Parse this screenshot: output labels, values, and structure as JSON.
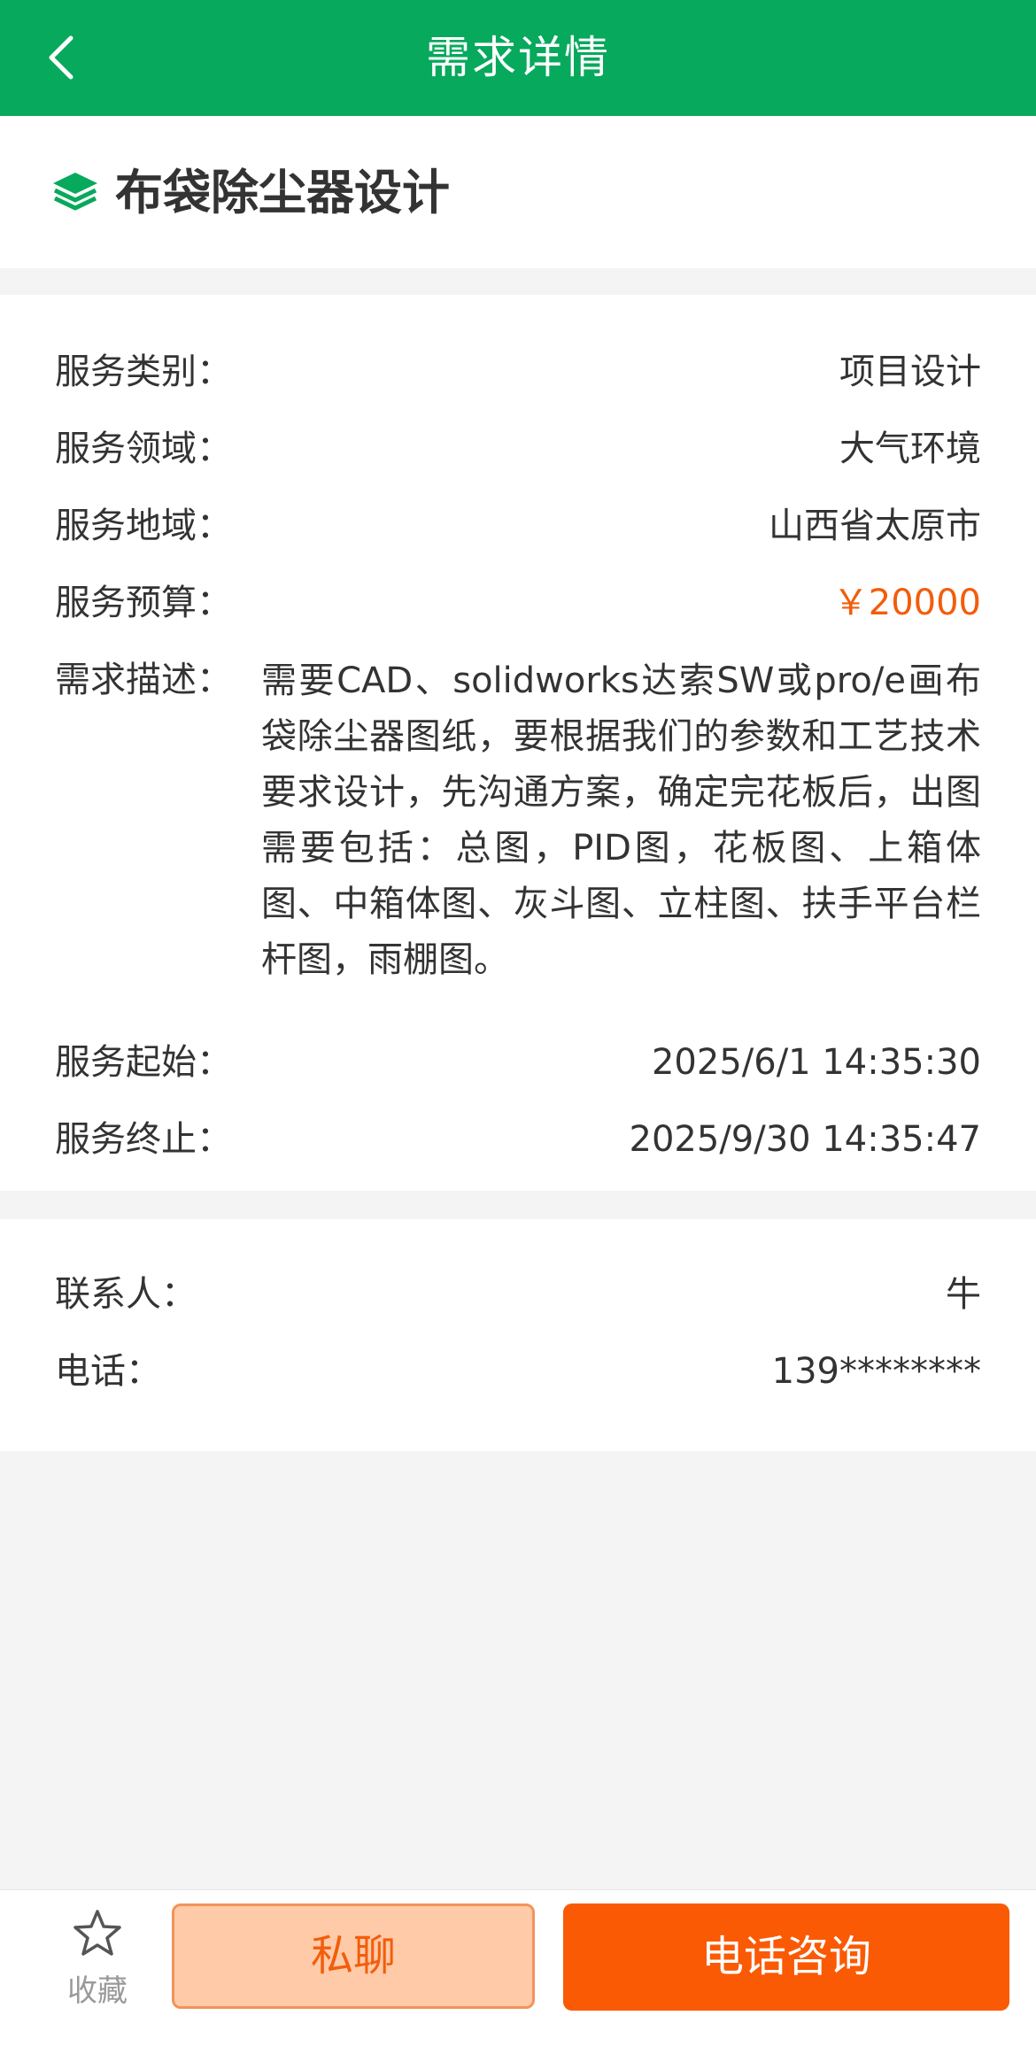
{
  "header": {
    "title": "需求详情"
  },
  "project": {
    "title": "布袋除尘器设计"
  },
  "details": {
    "category": {
      "label": "服务类别：",
      "value": "项目设计"
    },
    "field": {
      "label": "服务领域：",
      "value": "大气环境"
    },
    "region": {
      "label": "服务地域：",
      "value": "山西省太原市"
    },
    "budget": {
      "label": "服务预算：",
      "value": "￥20000"
    },
    "description": {
      "label": "需求描述：",
      "value": "需要CAD、solidworks达索SW或pro/e画布袋除尘器图纸，要根据我们的参数和工艺技术要求设计，先沟通方案，确定完花板后，出图需要包括：总图，PID图，花板图、上箱体图、中箱体图、灰斗图、立柱图、扶手平台栏杆图，雨棚图。"
    },
    "start": {
      "label": "服务起始：",
      "value": "2025/6/1 14:35:30"
    },
    "end": {
      "label": "服务终止：",
      "value": "2025/9/30 14:35:47"
    }
  },
  "contact": {
    "person": {
      "label": "联系人：",
      "value": "牛"
    },
    "phone": {
      "label": "电话：",
      "value": "139********"
    }
  },
  "actions": {
    "favorite_label": "收藏",
    "chat_label": "私聊",
    "call_label": "电话咨询"
  },
  "colors": {
    "brand_green": "#07a95c",
    "price_orange": "#f25d0b",
    "call_button": "#fa5a04",
    "chat_button": "#ffcaa8"
  },
  "icons": [
    "back-arrow-icon",
    "layers-icon",
    "star-icon"
  ]
}
